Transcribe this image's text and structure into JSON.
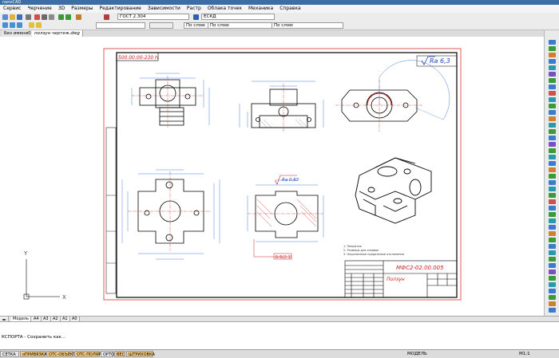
{
  "window": {
    "title": "nanoCAD"
  },
  "menu": [
    "Сервис",
    "Черчение",
    "3D",
    "Размеры",
    "Редактирование",
    "Зависимости",
    "Растр",
    "Облака точек",
    "Механика",
    "Справка"
  ],
  "properties_bar": {
    "text_style": "ГОСТ 2.304",
    "dim_style": "ЕСКД",
    "linetype": "По слою",
    "lineweight": "По слою",
    "color": "По слою"
  },
  "doc_tabs": [
    "Без имени0",
    "ползун чертеж.dwg"
  ],
  "drawing": {
    "stamp_code": "500.00.00-230 Н",
    "roughness_main": "Ra 6,3",
    "roughness_section": "Ra 0,63",
    "section_label": "Б-Б(2:1)",
    "title_block_code": "МФС2-02.00.005",
    "title_block_name": "Ползун",
    "notes": [
      "1. Покрытие",
      "2. Размеры для справок",
      "3. Неуказанные предельные отклонения"
    ]
  },
  "ucs": {
    "x": "X",
    "y": "Y"
  },
  "layout_tabs": [
    "Модель",
    "A4",
    "A3",
    "A2",
    "A1",
    "A0"
  ],
  "command_line": "КСПОРТА - Сохранить как...",
  "status": {
    "buttons": [
      "СЕТКА",
      "оПРИВЯЗКА",
      "ОТС-ОБЪЕКТ",
      "ОТС-ПОЛЯР",
      "ОРТО",
      "ВЕС",
      "ШТРИХОВКА"
    ],
    "active": [
      "оПРИВЯЗКА",
      "ОТС-ОБЪЕКТ",
      "ОТС-ПОЛЯР",
      "ВЕС",
      "ШТРИХОВКА"
    ],
    "mode": "МОДЕЛЬ",
    "scale": "M1:1"
  }
}
